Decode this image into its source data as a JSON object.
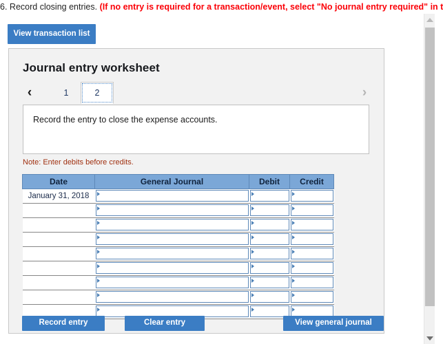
{
  "question": {
    "number": "6.",
    "prompt": "Record closing entries.",
    "instruction": "(If no entry is required for a transaction/event, select \"No journal entry required\" in the first"
  },
  "toolbar": {
    "view_transaction_list_label": "View transaction list"
  },
  "worksheet": {
    "title": "Journal entry worksheet",
    "prev_icon": "‹",
    "next_icon": "›",
    "tabs": [
      {
        "label": "1",
        "selected": false
      },
      {
        "label": "2",
        "selected": true
      }
    ],
    "entry_description": "Record the entry to close the expense accounts.",
    "note": "Note: Enter debits before credits."
  },
  "table": {
    "headers": [
      "Date",
      "General Journal",
      "Debit",
      "Credit"
    ],
    "rows": [
      {
        "date": "January 31, 2018",
        "general_journal": "",
        "debit": "",
        "credit": ""
      },
      {
        "date": "",
        "general_journal": "",
        "debit": "",
        "credit": ""
      },
      {
        "date": "",
        "general_journal": "",
        "debit": "",
        "credit": ""
      },
      {
        "date": "",
        "general_journal": "",
        "debit": "",
        "credit": ""
      },
      {
        "date": "",
        "general_journal": "",
        "debit": "",
        "credit": ""
      },
      {
        "date": "",
        "general_journal": "",
        "debit": "",
        "credit": ""
      },
      {
        "date": "",
        "general_journal": "",
        "debit": "",
        "credit": ""
      },
      {
        "date": "",
        "general_journal": "",
        "debit": "",
        "credit": ""
      },
      {
        "date": "",
        "general_journal": "",
        "debit": "",
        "credit": ""
      }
    ]
  },
  "actions": {
    "record_entry_label": "Record entry",
    "clear_entry_label": "Clear entry",
    "view_general_journal_label": "View general journal"
  },
  "scrollbar": {
    "up_icon": "scroll-up-arrow",
    "down_icon": "scroll-down-arrow"
  },
  "colors": {
    "accent_blue": "#3b7dc4",
    "header_blue": "#7ba7d7",
    "alert_red": "#fb0007",
    "note_red": "#a03010",
    "panel_bg": "#f2f2f2"
  }
}
